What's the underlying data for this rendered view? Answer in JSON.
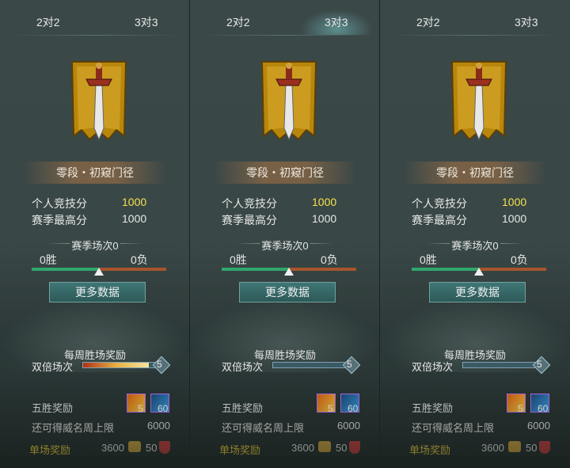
{
  "tabs": {
    "two_v_two": "2对2",
    "three_v_three": "3对3"
  },
  "colors": {
    "accent_yellow": "#f3e24a",
    "win_bar": "#2fa86e",
    "loss_bar": "#a8552c",
    "single_reward": "#f0d040"
  },
  "panels": [
    {
      "rank": "零段・初窥门径",
      "personal_score_label": "个人竞技分",
      "personal_score": "1000",
      "season_high_label": "赛季最高分",
      "season_high": "1000",
      "season_matches": "赛季场次0",
      "wins": "0胜",
      "losses": "0负",
      "win_ratio": 0.5,
      "more_data": "更多数据",
      "weekly_title": "每周胜场奖励",
      "double_label": "双倍场次",
      "double_value": "5",
      "double_fill": 0.85,
      "five_wins_label": "五胜奖励",
      "item1_count": "5",
      "item2_count": "60",
      "remaining_label": "还可得威名周上限",
      "remaining_value": "6000",
      "single_label": "单场奖励",
      "single_value1": "3600",
      "single_value2": "50",
      "icons": {
        "emblem": "sword-banner-icon",
        "coin": "coin-icon",
        "shield": "shield-icon"
      }
    },
    {
      "rank": "零段・初窥门径",
      "personal_score_label": "个人竞技分",
      "personal_score": "1000",
      "season_high_label": "赛季最高分",
      "season_high": "1000",
      "season_matches": "赛季场次0",
      "wins": "0胜",
      "losses": "0负",
      "win_ratio": 0.5,
      "more_data": "更多数据",
      "weekly_title": "每周胜场奖励",
      "double_label": "双倍场次",
      "double_value": "5",
      "double_fill": 0.0,
      "five_wins_label": "五胜奖励",
      "item1_count": "5",
      "item2_count": "60",
      "remaining_label": "还可得威名周上限",
      "remaining_value": "6000",
      "single_label": "单场奖励",
      "single_value1": "3600",
      "single_value2": "50",
      "icons": {
        "emblem": "sword-banner-icon",
        "coin": "coin-icon",
        "shield": "shield-icon"
      }
    },
    {
      "rank": "零段・初窥门径",
      "personal_score_label": "个人竞技分",
      "personal_score": "1000",
      "season_high_label": "赛季最高分",
      "season_high": "1000",
      "season_matches": "赛季场次0",
      "wins": "0胜",
      "losses": "0负",
      "win_ratio": 0.5,
      "more_data": "更多数据",
      "weekly_title": "每周胜场奖励",
      "double_label": "双倍场次",
      "double_value": "5",
      "double_fill": 0.0,
      "five_wins_label": "五胜奖励",
      "item1_count": "5",
      "item2_count": "60",
      "remaining_label": "还可得威名周上限",
      "remaining_value": "6000",
      "single_label": "单场奖励",
      "single_value1": "3600",
      "single_value2": "50",
      "icons": {
        "emblem": "sword-banner-icon",
        "coin": "coin-icon",
        "shield": "shield-icon"
      }
    }
  ]
}
